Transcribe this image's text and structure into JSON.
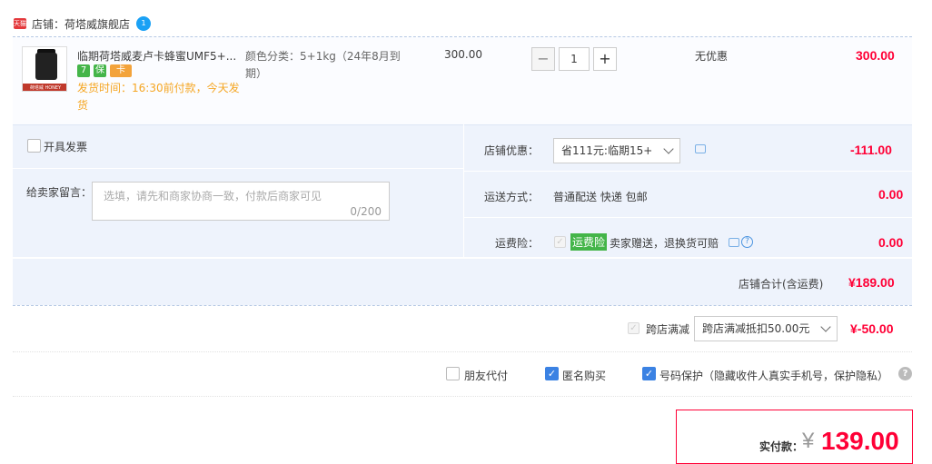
{
  "shop": {
    "badge": "天猫",
    "label": "店铺：荷塔威旗舰店",
    "icon": "shop-chat-icon",
    "icon_text": "1"
  },
  "item": {
    "title": "临期荷塔威麦卢卡蜂蜜UMF5+...",
    "spec": "颜色分类：5+1kg（24年8月到期）",
    "price": "300.00",
    "quantity": "1",
    "discount": "无优惠",
    "total": "300.00",
    "delivery_note": "发货时间：16:30前付款，今天发货",
    "badges": [
      "7",
      "保",
      "卡"
    ],
    "thumb_caption": "荷塔威 HONEY"
  },
  "invoice": {
    "label": "开具发票"
  },
  "message": {
    "label": "给卖家留言：",
    "placeholder": "选填，请先和商家协商一致，付款后商家可见",
    "counter": "0/200"
  },
  "store_discount": {
    "label": "店铺优惠：",
    "selected": "省111元:临期15+",
    "amount": "-111.00"
  },
  "shipping": {
    "label": "运送方式：",
    "value": "普通配送 快递 包邮",
    "amount": "0.00"
  },
  "insurance": {
    "label": "运费险：",
    "tag": "运费险",
    "text": "卖家赠送，退换货可赔",
    "amount": "0.00"
  },
  "store_total": {
    "label": "店铺合计(含运费)",
    "amount": "¥189.00"
  },
  "cross_store": {
    "label": "跨店满减",
    "selected": "跨店满减抵扣50.00元",
    "amount": "¥-50.00"
  },
  "options": {
    "friend_pay": "朋友代付",
    "anonymous": "匿名购买",
    "privacy": "号码保护（隐藏收件人真实手机号，保护隐私）"
  },
  "payment": {
    "label": "实付款：",
    "currency": "¥",
    "amount": "139.00"
  },
  "colors": {
    "accent": "#ff0036",
    "panel": "#eef3fc",
    "checkbox": "#3b82e3",
    "brand_tag": "#44b549"
  }
}
